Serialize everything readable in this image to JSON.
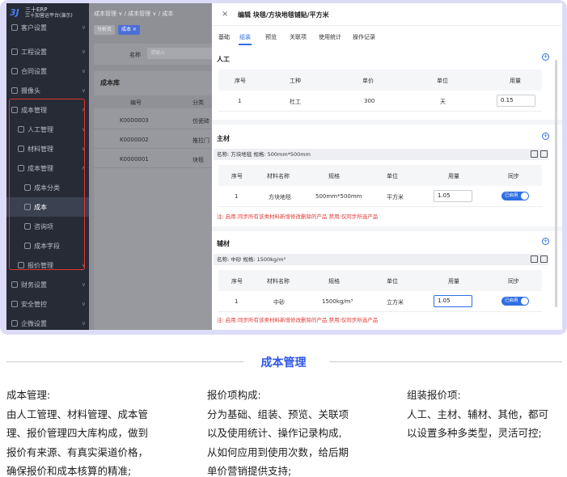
{
  "sidebar": {
    "logo_mark": "3J",
    "logo_line1": "三十ERP",
    "logo_line2": "三十加营运平台(演示)",
    "items": [
      {
        "label": "客户设置"
      },
      {
        "label": "工程设置"
      },
      {
        "label": "合同设置"
      },
      {
        "label": "摄像头"
      },
      {
        "label": "成本管理"
      },
      {
        "label": "人工管理"
      },
      {
        "label": "材料管理"
      },
      {
        "label": "成本管理"
      },
      {
        "label": "成本分类"
      },
      {
        "label": "成本"
      },
      {
        "label": "咨询项"
      },
      {
        "label": "成本字段"
      },
      {
        "label": "报价管理"
      },
      {
        "label": "财务设置"
      },
      {
        "label": "安全管控"
      },
      {
        "label": "企微设置"
      }
    ]
  },
  "background": {
    "breadcrumb": "成本管理 ∨ / 成本管理 ∨ / 成本",
    "tabs": [
      "分析页",
      "成本 ×"
    ],
    "search_label": "名称",
    "search_placeholder": "请输入",
    "library_title": "成本库",
    "columns": [
      "编号",
      "分类"
    ],
    "rows": [
      {
        "code": "K0000003",
        "type": "仿瓷砖"
      },
      {
        "code": "K0000002",
        "type": "推拉门"
      },
      {
        "code": "K0000001",
        "type": "块毯"
      }
    ]
  },
  "drawer": {
    "close": "×",
    "title": "编辑 块毯/方块地毯铺贴/平方米",
    "tabs": [
      "基础",
      "组装",
      "预览",
      "关联项",
      "使用统计",
      "操作记录"
    ],
    "labor": {
      "title": "人工",
      "headers": [
        "序号",
        "工种",
        "单价",
        "单位",
        "用量"
      ],
      "row": {
        "no": "1",
        "kind": "杜工",
        "price": "300",
        "unit": "天",
        "qty": "0.15"
      }
    },
    "main_material": {
      "title": "主材",
      "name_bar": "名称: 方块地毯 规格: 500mm*500mm",
      "headers": [
        "序号",
        "材料名称",
        "规格",
        "单位",
        "用量",
        "同步"
      ],
      "row": {
        "no": "1",
        "name": "方块地毯",
        "spec": "500mm*500mm",
        "unit": "平方米",
        "qty": "1.05",
        "sync": "已启用"
      },
      "note": "注: 启用:同步所有该类材料新增修改删除的产品 禁用:仅同步所选产品"
    },
    "aux_material": {
      "title": "辅材",
      "name_bar": "名称: 中砂    规格: 1500kg/m³",
      "headers": [
        "序号",
        "材料名称",
        "规格",
        "单位",
        "用量",
        "同步"
      ],
      "row": {
        "no": "1",
        "name": "中砂",
        "spec": "1500kg/m³",
        "unit": "立方米",
        "qty": "1.05",
        "sync": "已启用"
      },
      "note": "注: 启用:同步所有该类材料新增修改删除的产品 禁用:仅同步所选产品"
    },
    "add_icon": "+"
  },
  "caption": "成本管理",
  "features": [
    {
      "title": "成本管理:",
      "lines": [
        "由人工管理、材料管理、成本管",
        "理、报价管理四大库构成，做到",
        "报价有来源、有真实渠道价格，",
        "确保报价和成本核算的精准;"
      ]
    },
    {
      "title": "报价项构成:",
      "lines": [
        "分为基础、组装、预览、关联项",
        "以及使用统计、操作记录构成,",
        "从如何应用到使用次数，给后期",
        "单价营销提供支持;"
      ]
    },
    {
      "title": "组装报价项:",
      "lines": [
        "人工、主材、辅材、其他，都可",
        "以设置多种多类型，灵活可控;"
      ]
    }
  ]
}
